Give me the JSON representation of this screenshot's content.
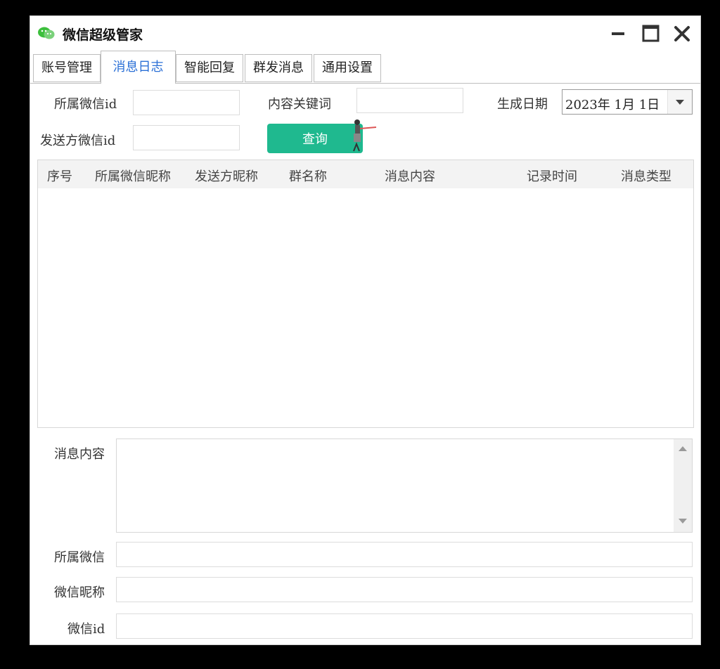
{
  "window": {
    "title": "微信超级管家"
  },
  "tabs": [
    {
      "label": "账号管理",
      "active": false
    },
    {
      "label": "消息日志",
      "active": true
    },
    {
      "label": "智能回复",
      "active": false
    },
    {
      "label": "群发消息",
      "active": false
    },
    {
      "label": "通用设置",
      "active": false
    }
  ],
  "filters": {
    "owner_id_label": "所属微信id",
    "owner_id_value": "",
    "keyword_label": "内容关键词",
    "keyword_value": "",
    "date_label": "生成日期",
    "date_value": "2023年  1月  1日",
    "sender_id_label": "发送方微信id",
    "sender_id_value": "",
    "query_button": "查询"
  },
  "table": {
    "columns": [
      "序号",
      "所属微信昵称",
      "发送方昵称",
      "群名称",
      "消息内容",
      "记录时间",
      "消息类型"
    ],
    "rows": []
  },
  "details": {
    "content_label": "消息内容",
    "content_value": "",
    "owner_label": "所属微信",
    "owner_value": "",
    "nickname_label": "微信昵称",
    "nickname_value": "",
    "wxid_label": "微信id",
    "wxid_value": ""
  },
  "colors": {
    "accent": "#1fb98f",
    "active_tab": "#2a6fd6"
  },
  "icons": [
    "app-logo-icon",
    "minimize-icon",
    "maximize-icon",
    "close-icon",
    "chevron-down-icon",
    "scroll-up-icon",
    "scroll-down-icon"
  ]
}
